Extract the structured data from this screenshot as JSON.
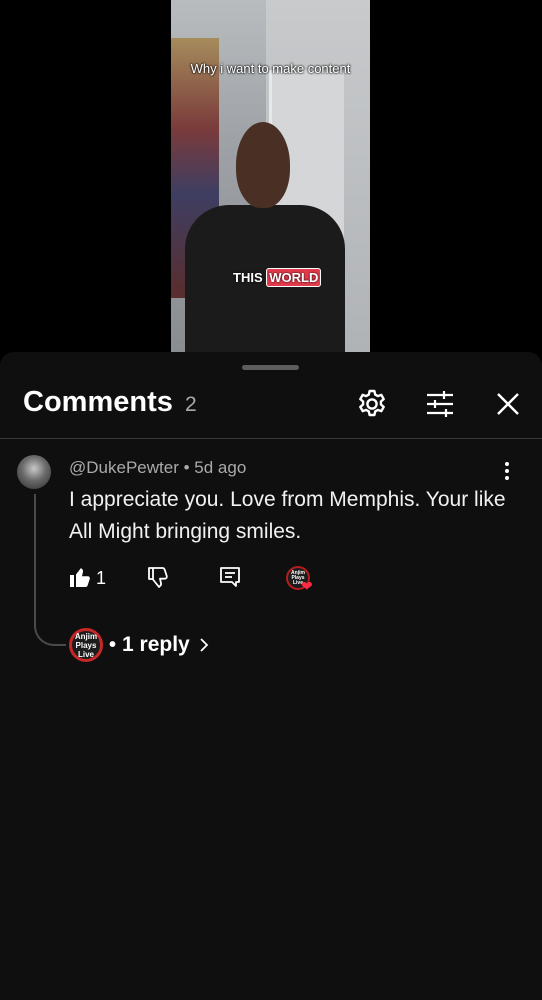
{
  "video": {
    "caption_top": "Why i want to make content",
    "caption_mid_prefix": "THIS",
    "caption_mid_highlight": "WORLD"
  },
  "comments_panel": {
    "title": "Comments",
    "count": "2",
    "icons": [
      "gear-icon",
      "filter-sliders-icon",
      "close-icon"
    ]
  },
  "comment": {
    "author": "@DukePewter",
    "separator": "•",
    "time": "5d ago",
    "text": "I appreciate you. Love from Memphis. Your like All Might bringing smiles.",
    "likes": "1",
    "creator_badge_text": "Anjim Plays Live"
  },
  "replies": {
    "avatar_text": "Anjim Plays Live",
    "dot": "•",
    "label": "1 reply"
  },
  "colors": {
    "background": "#0f0f0f",
    "text_primary": "#f1f1f1",
    "text_secondary": "#aaaaaa",
    "heart": "#ff2b43"
  }
}
